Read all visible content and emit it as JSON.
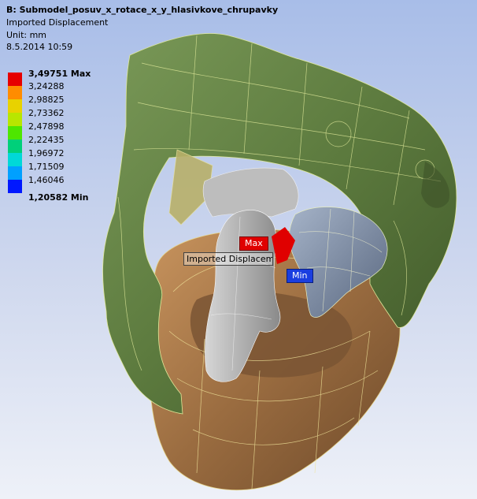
{
  "header": {
    "title": "B: Submodel_posuv_x_rotace_x_y_hlasivkove_chrupavky",
    "result_type": "Imported Displacement",
    "unit": "Unit: mm",
    "date": "8.5.2014 10:59"
  },
  "legend": {
    "max_label": "3,49751 Max",
    "levels": [
      "3,24288",
      "2,98825",
      "2,73362",
      "2,47898",
      "2,22435",
      "1,96972",
      "1,71509",
      "1,46046"
    ],
    "min_label": "1,20582 Min",
    "colors": [
      "#e60000",
      "#ff8c00",
      "#e8d200",
      "#b8e600",
      "#4ee600",
      "#00d07a",
      "#00d8d8",
      "#00a0ff",
      "#0018ff"
    ]
  },
  "markers": {
    "max": "Max",
    "min": "Min",
    "probe": "Imported Displacement"
  },
  "model_colors": {
    "thyroid": "#5d7a40",
    "arytenoid": "#7d8aa0",
    "cricoid": "#a07447",
    "vocal_fold": "#a9a9a9"
  }
}
